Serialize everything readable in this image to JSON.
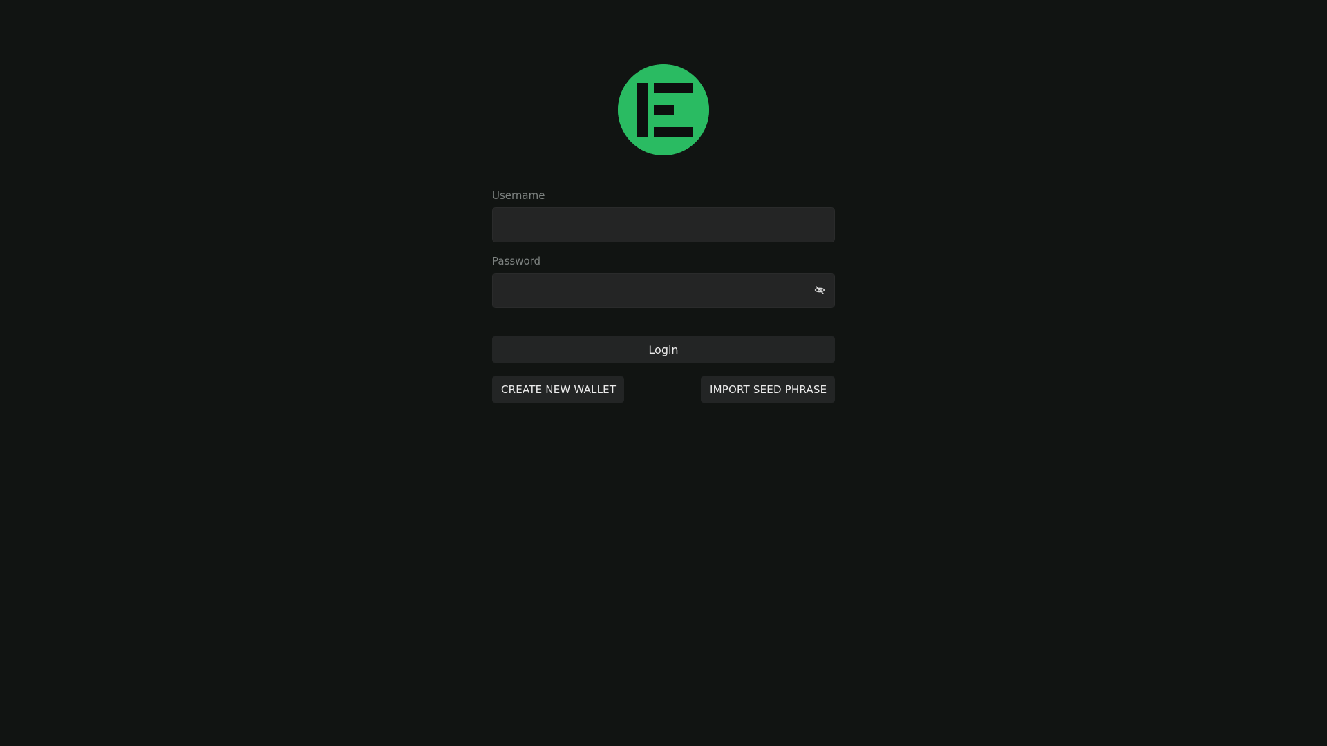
{
  "logo": {
    "name": "E-logo",
    "color": "#2abb62"
  },
  "form": {
    "username": {
      "label": "Username",
      "value": "",
      "placeholder": ""
    },
    "password": {
      "label": "Password",
      "value": "",
      "placeholder": "",
      "toggle_icon": "eye-off-icon"
    }
  },
  "actions": {
    "login_label": "Login",
    "create_wallet_label": "CREATE NEW WALLET",
    "import_seed_label": "IMPORT SEED PHRASE"
  },
  "colors": {
    "background": "#111412",
    "input_background": "#242525",
    "button_background": "#232525",
    "accent": "#2abb62"
  }
}
